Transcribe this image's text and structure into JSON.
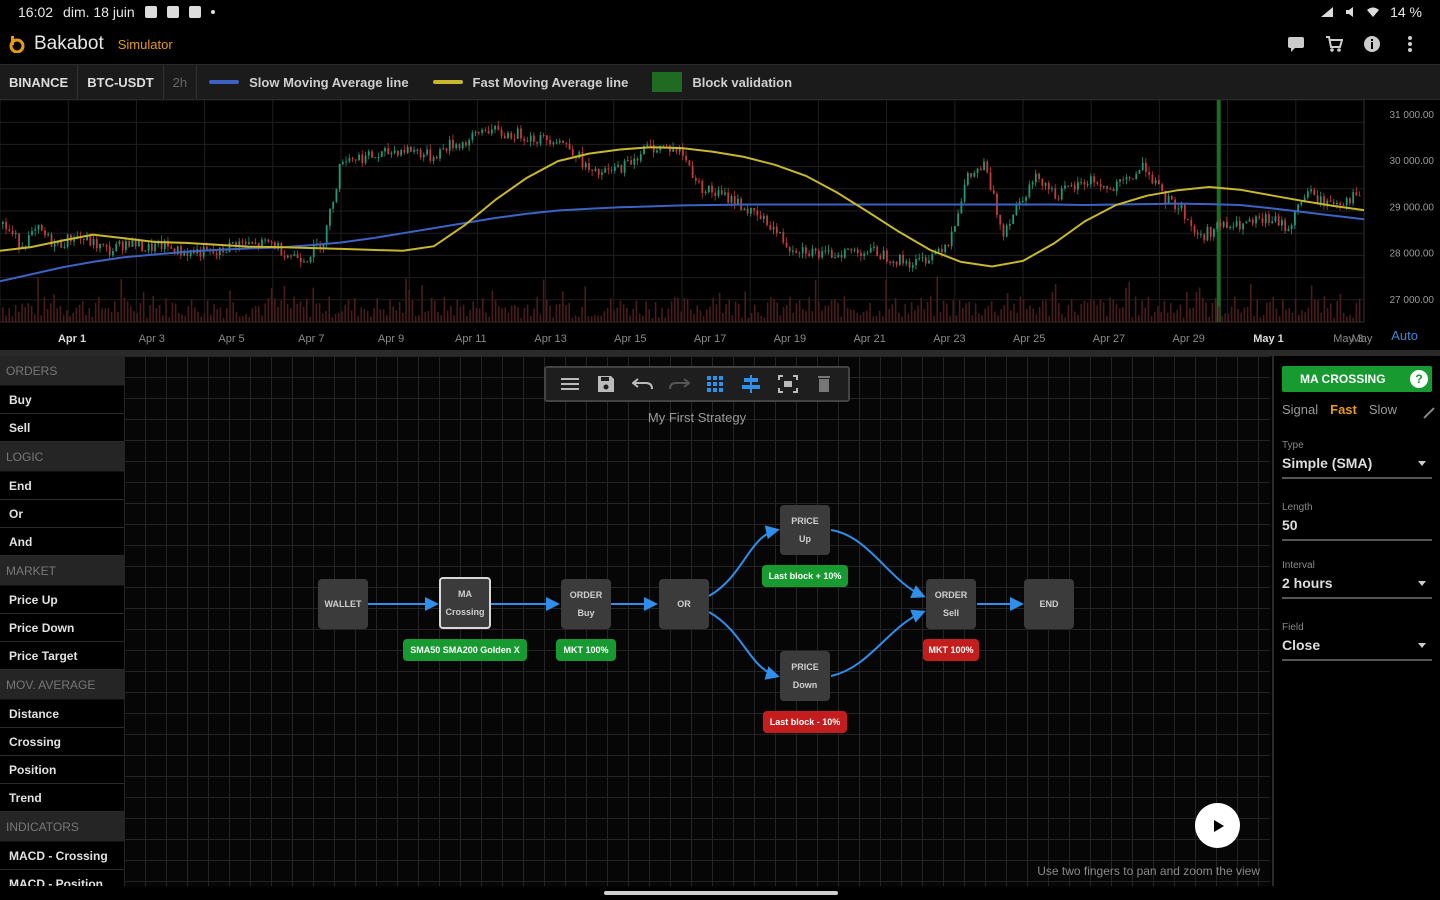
{
  "status_bar": {
    "time": "16:02",
    "date": "dim. 18 juin",
    "battery": "14 %"
  },
  "app": {
    "name": "Bakabot",
    "mode": "Simulator"
  },
  "icons": {
    "header_actions": [
      "chat-icon",
      "cart-icon",
      "info-icon",
      "more-vert-icon"
    ]
  },
  "market": {
    "exchange": "BINANCE",
    "pair": "BTC-USDT",
    "interval": "2h"
  },
  "legend": {
    "slow_ma": {
      "label": "Slow Moving Average line",
      "color": "#3b63c4"
    },
    "fast_ma": {
      "label": "Fast Moving Average line",
      "color": "#c9b72c"
    },
    "block": {
      "label": "Block validation",
      "color": "#1f6b22"
    }
  },
  "chart_data": {
    "type": "line",
    "x_ticks": [
      "Apr 1",
      "Apr 3",
      "Apr 5",
      "Apr 7",
      "Apr 9",
      "Apr 11",
      "Apr 13",
      "Apr 15",
      "Apr 17",
      "Apr 19",
      "Apr 21",
      "Apr 23",
      "Apr 25",
      "Apr 27",
      "Apr 29",
      "May 1",
      "May 3",
      "May"
    ],
    "y_ticks": [
      "31 000.00",
      "30 000.00",
      "29 000.00",
      "28 000.00",
      "27 000.00"
    ],
    "ylim": [
      26500,
      31300
    ],
    "price": [
      28620,
      28180,
      28480,
      28140,
      28360,
      28210,
      28020,
      28250,
      28090,
      28150,
      28010,
      28020,
      27960,
      28220,
      28150,
      28220,
      27960,
      27890,
      28300,
      30050,
      30060,
      30080,
      30210,
      30230,
      30060,
      30330,
      30380,
      30700,
      30550,
      30560,
      30450,
      30480,
      30200,
      29680,
      29740,
      29920,
      30260,
      30290,
      30200,
      29450,
      29260,
      29140,
      28820,
      28610,
      28130,
      28070,
      27920,
      28020,
      28040,
      28000,
      27860,
      27750,
      27950,
      28260,
      29590,
      29880,
      28440,
      29170,
      29670,
      29240,
      29410,
      29590,
      29320,
      29560,
      29890,
      29180,
      28960,
      28310,
      28560,
      28560,
      28630,
      28730,
      28520,
      29330,
      29080,
      29110,
      29240
    ],
    "fast_ma": [
      28040,
      28120,
      28260,
      28390,
      28310,
      28230,
      28210,
      28170,
      28130,
      28120,
      28100,
      28080,
      28060,
      28040,
      28140,
      28600,
      29150,
      29620,
      29980,
      30140,
      30230,
      30280,
      30260,
      30180,
      30070,
      29900,
      29660,
      29300,
      28880,
      28450,
      28060,
      27800,
      27700,
      27820,
      28200,
      28680,
      29030,
      29230,
      29350,
      29420,
      29360,
      29240,
      29120,
      29010,
      28920
    ],
    "slow_ma": [
      27380,
      27530,
      27680,
      27800,
      27900,
      27960,
      28020,
      28060,
      28090,
      28110,
      28160,
      28220,
      28310,
      28420,
      28530,
      28640,
      28750,
      28840,
      28910,
      28950,
      28980,
      29000,
      29020,
      29030,
      29040,
      29040,
      29040,
      29040,
      29040,
      29040,
      29040,
      29040,
      29040,
      29040,
      29040,
      29030,
      29040,
      29050,
      29060,
      29050,
      29030,
      28960,
      28880,
      28800,
      28720
    ],
    "block_marker": "Apr 29",
    "series": [
      {
        "name": "Slow Moving Average line",
        "color": "#3b63c4"
      },
      {
        "name": "Fast Moving Average line",
        "color": "#c9b72c"
      }
    ],
    "grid": true,
    "scale_mode": "Auto"
  },
  "sidebar": {
    "sections": [
      {
        "title": "ORDERS",
        "items": [
          "Buy",
          "Sell"
        ]
      },
      {
        "title": "LOGIC",
        "items": [
          "End",
          "Or",
          "And"
        ]
      },
      {
        "title": "MARKET",
        "items": [
          "Price Up",
          "Price Down",
          "Price Target"
        ]
      },
      {
        "title": "MOV. AVERAGE",
        "items": [
          "Distance",
          "Crossing",
          "Position",
          "Trend"
        ]
      },
      {
        "title": "INDICATORS",
        "items": [
          "MACD - Crossing",
          "MACD - Position"
        ]
      }
    ]
  },
  "toolbar": {
    "icons": [
      "list-icon",
      "save-icon",
      "undo-icon",
      "redo-icon",
      "grid-icon",
      "align-icon",
      "fit-screen-icon",
      "delete-icon"
    ]
  },
  "strategy": {
    "name": "My First Strategy"
  },
  "flow": {
    "wallet": {
      "label": "WALLET"
    },
    "ma_crossing": {
      "line1": "MA",
      "line2": "Crossing",
      "tag": "SMA50 SMA200 Golden X"
    },
    "order_buy": {
      "line1": "ORDER",
      "line2": "Buy",
      "tag": "MKT 100%"
    },
    "or": {
      "label": "OR"
    },
    "price_up": {
      "line1": "PRICE",
      "line2": "Up",
      "tag": "Last block + 10%"
    },
    "price_down": {
      "line1": "PRICE",
      "line2": "Down",
      "tag": "Last block - 10%"
    },
    "order_sell": {
      "line1": "ORDER",
      "line2": "Sell",
      "tag": "MKT 100%"
    },
    "end": {
      "label": "END"
    }
  },
  "canvas_hint": "Use two fingers to pan and zoom the view",
  "panel": {
    "title": "MA CROSSING",
    "help": "?",
    "tabs": [
      "Signal",
      "Fast",
      "Slow"
    ],
    "active_tab": "Fast",
    "fields": [
      {
        "label": "Type",
        "value": "Simple (SMA)",
        "dropdown": true
      },
      {
        "label": "Length",
        "value": "50",
        "dropdown": false
      },
      {
        "label": "Interval",
        "value": "2 hours",
        "dropdown": true
      },
      {
        "label": "Field",
        "value": "Close",
        "dropdown": true
      }
    ]
  }
}
